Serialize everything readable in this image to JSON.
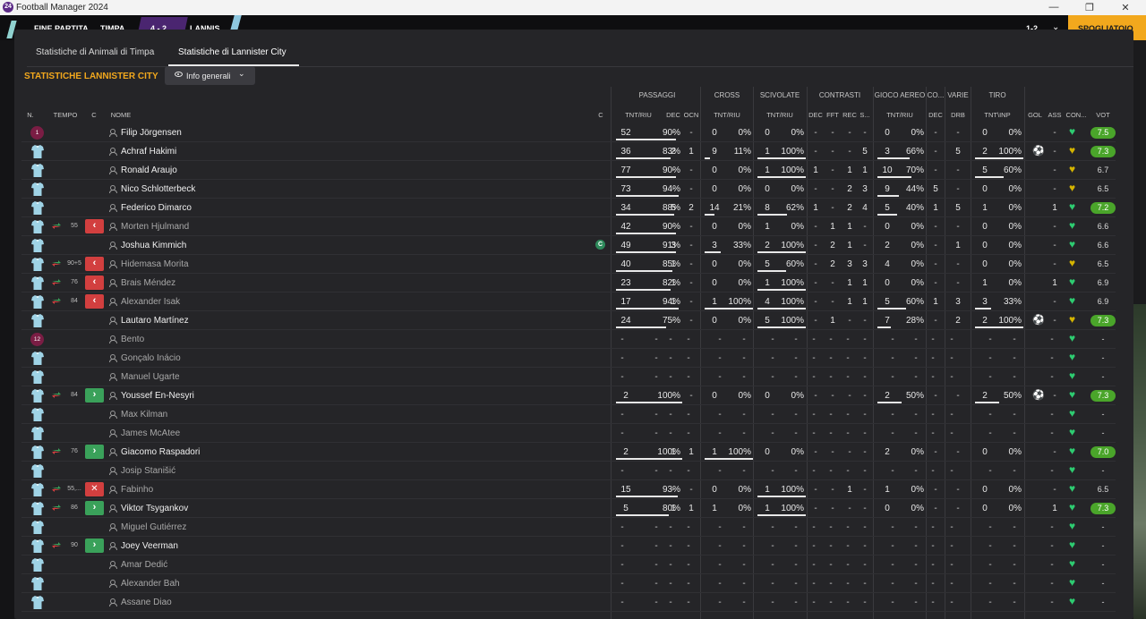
{
  "window": {
    "title": "Football Manager 2024",
    "logo": "24",
    "minimize": "—",
    "restore": "❐",
    "close": "✕"
  },
  "match": {
    "status": "FINE PARTITA",
    "home_short": "TIMPA",
    "score": "4 - 2",
    "away_short": "LANNIS",
    "right_score": "1-2",
    "right_btn": "SPOGLIATOIO"
  },
  "tabs": [
    {
      "label": "Statistiche di Animali di Timpa"
    },
    {
      "label": "Statistiche di Lannister City"
    }
  ],
  "section_title": "STATISTICHE LANNISTER CITY",
  "view_dropdown": {
    "label": "Info generali",
    "icon": "eye-icon"
  },
  "groups": {
    "passaggi": "PASSAGGI",
    "cross": "CROSS",
    "scivolate": "SCIVOLATE",
    "contrasti": "CONTRASTI",
    "gioco_aereo": "GIOCO AEREO",
    "co": "CO...",
    "varie": "VARIE",
    "tiro": "TIRO"
  },
  "columns": {
    "n": "N.",
    "tempo": "TEMPO",
    "c": "C",
    "nome": "NOME",
    "capt": "C",
    "pass": "TNT/RIU",
    "dec": "DEC",
    "ocn": "OCN",
    "cross": "TNT/RIU",
    "sciv": "TNT/RIU",
    "cdec": "DEC",
    "fft": "FFT",
    "rec": "REC",
    "s": "S...",
    "air": "TNT/RIU",
    "codec": "DEC",
    "drb": "DRB",
    "tiro": "TNT\\INP",
    "gol": "GOL",
    "ass": "ASS",
    "con": "CON...",
    "vot": "VOT"
  },
  "colors": {
    "accent": "#f2a81d",
    "sub_in": "#3aa15a",
    "sub_out": "#d23f3f",
    "rating_hi": "#4aa52a",
    "heart_green": "#2ecc71",
    "heart_yellow": "#d4b400",
    "gk": "#7a1d44"
  },
  "players": [
    {
      "num": "1",
      "gk": true,
      "name": "Filip Jörgensen",
      "pass": [
        "52",
        "90%"
      ],
      "dec": "-",
      "ocn": "-",
      "cross": [
        "0",
        "0%"
      ],
      "sciv": [
        "0",
        "0%"
      ],
      "cdec": "-",
      "fft": "-",
      "rec": "-",
      "s": "-",
      "air": [
        "0",
        "0%"
      ],
      "codec": "-",
      "drb": "-",
      "tiro": [
        "0",
        "0%"
      ],
      "gol": "",
      "ass": "-",
      "con": "green",
      "vot": "7.5",
      "hi": true
    },
    {
      "name": "Achraf Hakimi",
      "pass": [
        "36",
        "83%"
      ],
      "dec": "2",
      "ocn": "1",
      "cross": [
        "9",
        "11%"
      ],
      "sciv": [
        "1",
        "100%"
      ],
      "cdec": "-",
      "fft": "-",
      "rec": "-",
      "s": "5",
      "air": [
        "3",
        "66%"
      ],
      "codec": "-",
      "drb": "5",
      "tiro": [
        "2",
        "100%"
      ],
      "gol": "⚽",
      "ass": "-",
      "con": "yellow",
      "vot": "7.3",
      "hi": true
    },
    {
      "name": "Ronald Araujo",
      "pass": [
        "77",
        "90%"
      ],
      "dec": "-",
      "ocn": "-",
      "cross": [
        "0",
        "0%"
      ],
      "sciv": [
        "1",
        "100%"
      ],
      "cdec": "1",
      "fft": "-",
      "rec": "1",
      "s": "1",
      "air": [
        "10",
        "70%"
      ],
      "codec": "-",
      "drb": "-",
      "tiro": [
        "5",
        "60%"
      ],
      "gol": "",
      "ass": "-",
      "con": "yellow",
      "vot": "6.7"
    },
    {
      "name": "Nico Schlotterbeck",
      "pass": [
        "73",
        "94%"
      ],
      "dec": "-",
      "ocn": "-",
      "cross": [
        "0",
        "0%"
      ],
      "sciv": [
        "0",
        "0%"
      ],
      "cdec": "-",
      "fft": "-",
      "rec": "2",
      "s": "3",
      "air": [
        "9",
        "44%"
      ],
      "codec": "5",
      "drb": "-",
      "tiro": [
        "0",
        "0%"
      ],
      "gol": "",
      "ass": "-",
      "con": "yellow",
      "vot": "6.5"
    },
    {
      "name": "Federico Dimarco",
      "pass": [
        "34",
        "88%"
      ],
      "dec": "5",
      "ocn": "2",
      "cross": [
        "14",
        "21%"
      ],
      "sciv": [
        "8",
        "62%"
      ],
      "cdec": "1",
      "fft": "-",
      "rec": "2",
      "s": "4",
      "air": [
        "5",
        "40%"
      ],
      "codec": "1",
      "drb": "5",
      "tiro": [
        "1",
        "0%"
      ],
      "gol": "",
      "ass": "1",
      "con": "green",
      "vot": "7.2",
      "hi": true
    },
    {
      "name": "Morten Hjulmand",
      "dim": true,
      "sub": "out",
      "min": "55",
      "pass": [
        "42",
        "90%"
      ],
      "dec": "-",
      "ocn": "-",
      "cross": [
        "0",
        "0%"
      ],
      "sciv": [
        "1",
        "0%"
      ],
      "cdec": "-",
      "fft": "1",
      "rec": "1",
      "s": "-",
      "air": [
        "0",
        "0%"
      ],
      "codec": "-",
      "drb": "-",
      "tiro": [
        "0",
        "0%"
      ],
      "gol": "",
      "ass": "-",
      "con": "green",
      "vot": "6.6"
    },
    {
      "name": "Joshua Kimmich",
      "capt": "C",
      "pass": [
        "49",
        "91%"
      ],
      "dec": "3",
      "ocn": "-",
      "cross": [
        "3",
        "33%"
      ],
      "sciv": [
        "2",
        "100%"
      ],
      "cdec": "-",
      "fft": "2",
      "rec": "1",
      "s": "-",
      "air": [
        "2",
        "0%"
      ],
      "codec": "-",
      "drb": "1",
      "tiro": [
        "0",
        "0%"
      ],
      "gol": "",
      "ass": "-",
      "con": "green",
      "vot": "6.6"
    },
    {
      "name": "Hidemasa Morita",
      "dim": true,
      "sub": "out",
      "min": "90+5",
      "pass": [
        "40",
        "85%"
      ],
      "dec": "1",
      "ocn": "-",
      "cross": [
        "0",
        "0%"
      ],
      "sciv": [
        "5",
        "60%"
      ],
      "cdec": "-",
      "fft": "2",
      "rec": "3",
      "s": "3",
      "air": [
        "4",
        "0%"
      ],
      "codec": "-",
      "drb": "-",
      "tiro": [
        "0",
        "0%"
      ],
      "gol": "",
      "ass": "-",
      "con": "yellow",
      "vot": "6.5"
    },
    {
      "name": "Brais Méndez",
      "dim": true,
      "sub": "out",
      "min": "76",
      "pass": [
        "23",
        "82%"
      ],
      "dec": "1",
      "ocn": "-",
      "cross": [
        "0",
        "0%"
      ],
      "sciv": [
        "1",
        "100%"
      ],
      "cdec": "-",
      "fft": "-",
      "rec": "1",
      "s": "1",
      "air": [
        "0",
        "0%"
      ],
      "codec": "-",
      "drb": "-",
      "tiro": [
        "1",
        "0%"
      ],
      "gol": "",
      "ass": "1",
      "con": "green",
      "vot": "6.9"
    },
    {
      "name": "Alexander Isak",
      "dim": true,
      "sub": "out",
      "min": "84",
      "pass": [
        "17",
        "94%"
      ],
      "dec": "1",
      "ocn": "-",
      "cross": [
        "1",
        "100%"
      ],
      "sciv": [
        "4",
        "100%"
      ],
      "cdec": "-",
      "fft": "-",
      "rec": "1",
      "s": "1",
      "air": [
        "5",
        "60%"
      ],
      "codec": "1",
      "drb": "3",
      "tiro": [
        "3",
        "33%"
      ],
      "gol": "",
      "ass": "-",
      "con": "green",
      "vot": "6.9"
    },
    {
      "name": "Lautaro Martínez",
      "pass": [
        "24",
        "75%"
      ],
      "dec": "-",
      "ocn": "-",
      "cross": [
        "0",
        "0%"
      ],
      "sciv": [
        "5",
        "100%"
      ],
      "cdec": "-",
      "fft": "1",
      "rec": "-",
      "s": "-",
      "air": [
        "7",
        "28%"
      ],
      "codec": "-",
      "drb": "2",
      "tiro": [
        "2",
        "100%"
      ],
      "gol": "⚽",
      "ass": "-",
      "con": "yellow",
      "vot": "7.3",
      "hi": true
    },
    {
      "num": "12",
      "gk": true,
      "name": "Bento",
      "dim": true,
      "empty": true,
      "con": "green",
      "vot": "-"
    },
    {
      "name": "Gonçalo Inácio",
      "dim": true,
      "empty": true,
      "con": "green",
      "vot": "-"
    },
    {
      "name": "Manuel Ugarte",
      "dim": true,
      "empty": true,
      "con": "green",
      "vot": "-"
    },
    {
      "name": "Youssef En-Nesyri",
      "sub": "in",
      "min": "84",
      "pass": [
        "2",
        "100%"
      ],
      "dec": "-",
      "ocn": "-",
      "cross": [
        "0",
        "0%"
      ],
      "sciv": [
        "0",
        "0%"
      ],
      "cdec": "-",
      "fft": "-",
      "rec": "-",
      "s": "-",
      "air": [
        "2",
        "50%"
      ],
      "codec": "-",
      "drb": "-",
      "tiro": [
        "2",
        "50%"
      ],
      "gol": "⚽",
      "ass": "-",
      "con": "green",
      "vot": "7.3",
      "hi": true
    },
    {
      "name": "Max Kilman",
      "dim": true,
      "empty": true,
      "con": "green",
      "vot": "-"
    },
    {
      "name": "James McAtee",
      "dim": true,
      "empty": true,
      "con": "green",
      "vot": "-"
    },
    {
      "name": "Giacomo Raspadori",
      "sub": "in",
      "min": "76",
      "pass": [
        "2",
        "100%"
      ],
      "dec": "1",
      "ocn": "1",
      "cross": [
        "1",
        "100%"
      ],
      "sciv": [
        "0",
        "0%"
      ],
      "cdec": "-",
      "fft": "-",
      "rec": "-",
      "s": "-",
      "air": [
        "2",
        "0%"
      ],
      "codec": "-",
      "drb": "-",
      "tiro": [
        "0",
        "0%"
      ],
      "gol": "",
      "ass": "-",
      "con": "green",
      "vot": "7.0",
      "hi": true
    },
    {
      "name": "Josip Stanišić",
      "dim": true,
      "empty": true,
      "con": "green",
      "vot": "-"
    },
    {
      "name": "Fabinho",
      "dim": true,
      "sub": "both",
      "min": "55,...",
      "pass": [
        "15",
        "93%"
      ],
      "dec": "-",
      "ocn": "-",
      "cross": [
        "0",
        "0%"
      ],
      "sciv": [
        "1",
        "100%"
      ],
      "cdec": "-",
      "fft": "-",
      "rec": "1",
      "s": "-",
      "air": [
        "1",
        "0%"
      ],
      "codec": "-",
      "drb": "-",
      "tiro": [
        "0",
        "0%"
      ],
      "gol": "",
      "ass": "-",
      "con": "green",
      "vot": "6.5"
    },
    {
      "name": "Viktor Tsygankov",
      "sub": "in",
      "min": "86",
      "pass": [
        "5",
        "80%"
      ],
      "dec": "1",
      "ocn": "1",
      "cross": [
        "1",
        "0%"
      ],
      "sciv": [
        "1",
        "100%"
      ],
      "cdec": "-",
      "fft": "-",
      "rec": "-",
      "s": "-",
      "air": [
        "0",
        "0%"
      ],
      "codec": "-",
      "drb": "-",
      "tiro": [
        "0",
        "0%"
      ],
      "gol": "",
      "ass": "1",
      "con": "green",
      "vot": "7.3",
      "hi": true
    },
    {
      "name": "Miguel Gutiérrez",
      "dim": true,
      "empty": true,
      "con": "green",
      "vot": "-"
    },
    {
      "name": "Joey Veerman",
      "sub": "in",
      "min": "90",
      "empty": true,
      "con": "green",
      "vot": "-"
    },
    {
      "name": "Amar Dedić",
      "dim": true,
      "empty": true,
      "con": "green",
      "vot": "-"
    },
    {
      "name": "Alexander Bah",
      "dim": true,
      "empty": true,
      "con": "green",
      "vot": "-"
    },
    {
      "name": "Assane Diao",
      "dim": true,
      "empty": true,
      "con": "green",
      "vot": "-"
    }
  ]
}
